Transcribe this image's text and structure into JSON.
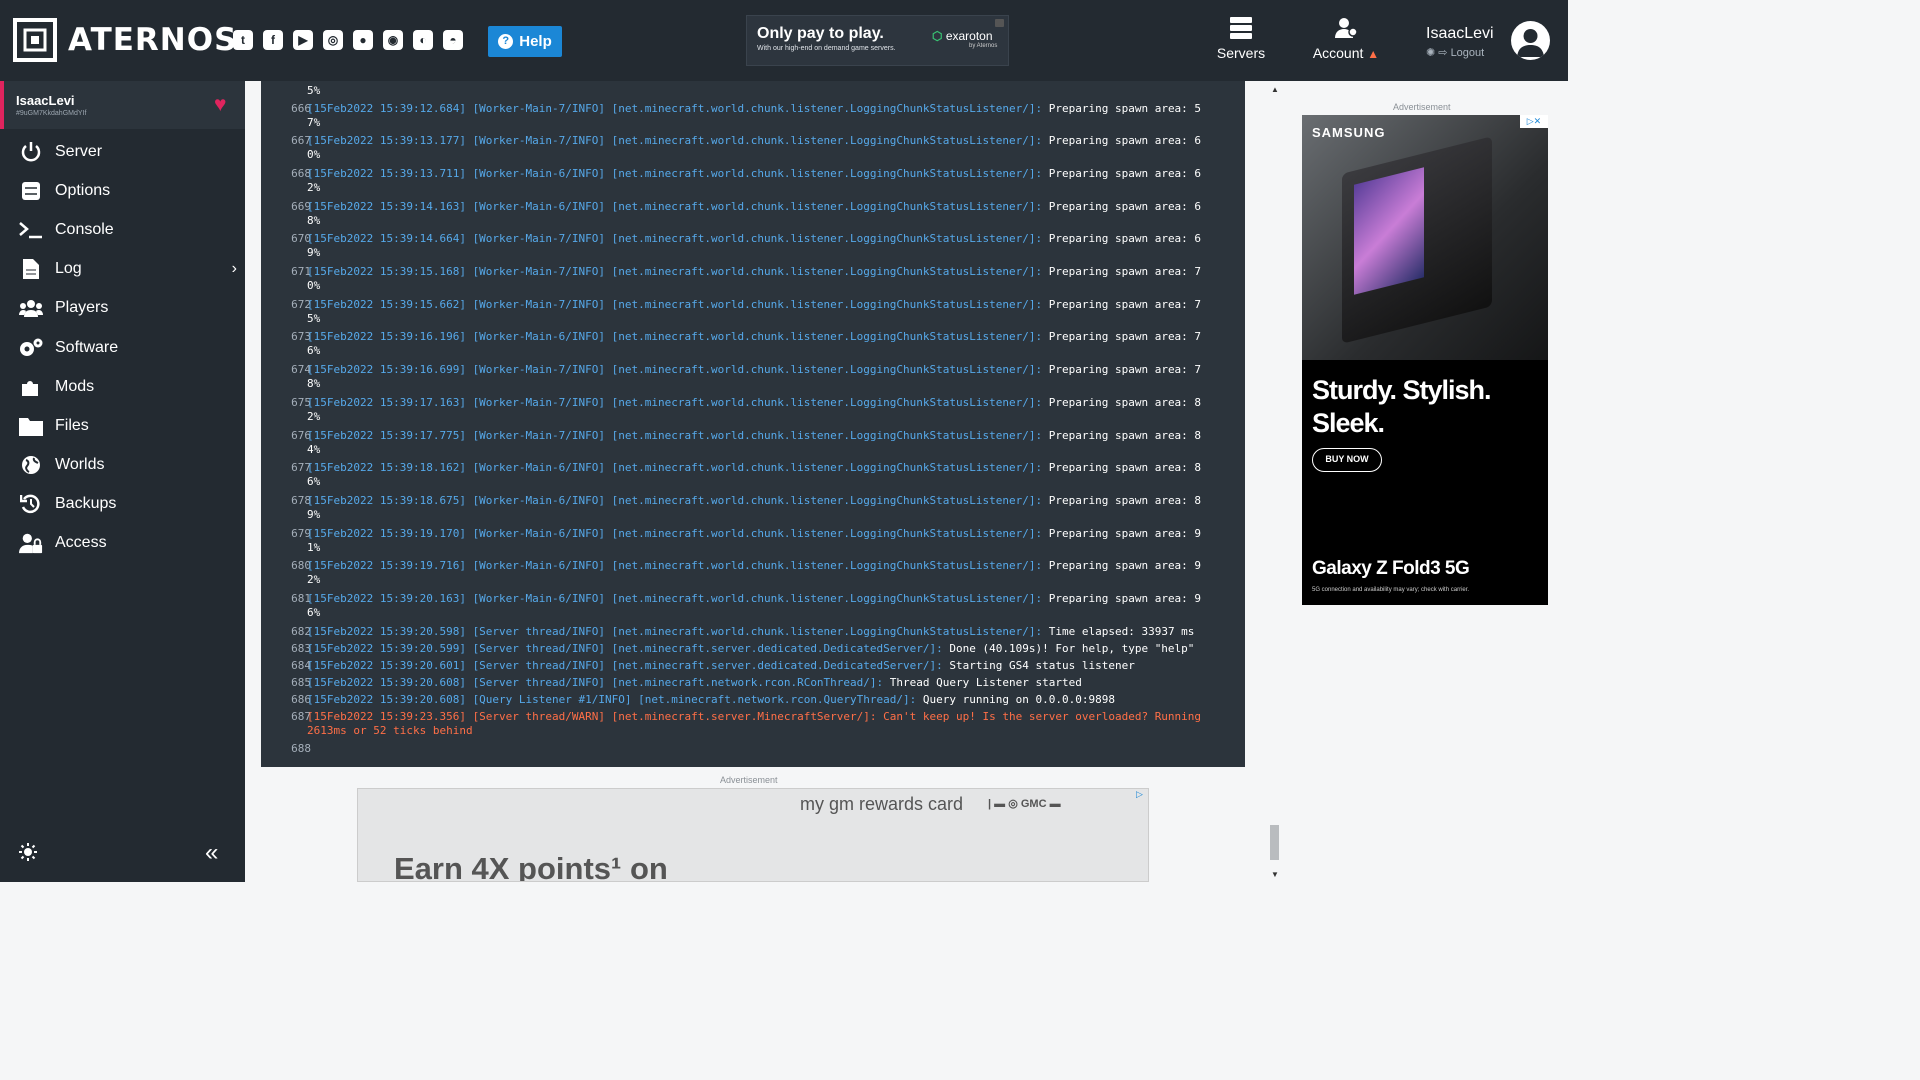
{
  "header": {
    "brand": "ATERNOS",
    "socials": [
      "twitter-icon",
      "facebook-icon",
      "youtube-icon",
      "instagram-icon",
      "reddit-icon",
      "discord-icon",
      "teamspeak-icon",
      "github-icon"
    ],
    "help_label": "Help",
    "top_ad": {
      "headline": "Only pay to play.",
      "sub": "With our high-end on demand game servers.",
      "brand": "exaroton",
      "by": "by Aternos"
    },
    "nav": [
      {
        "label": "Servers",
        "icon": "servers-icon"
      },
      {
        "label": "Account",
        "icon": "account-icon"
      }
    ],
    "user": {
      "name": "IsaacLevi",
      "logout": "Logout"
    }
  },
  "sidebar": {
    "server_name": "IsaacLevi",
    "server_id": "#9uGM7KkdahGMdYIf",
    "items": [
      {
        "label": "Server",
        "icon": "power-icon"
      },
      {
        "label": "Options",
        "icon": "sliders-icon"
      },
      {
        "label": "Console",
        "icon": "terminal-icon"
      },
      {
        "label": "Log",
        "icon": "file-icon"
      },
      {
        "label": "Players",
        "icon": "users-icon"
      },
      {
        "label": "Software",
        "icon": "gears-icon"
      },
      {
        "label": "Mods",
        "icon": "puzzle-icon"
      },
      {
        "label": "Files",
        "icon": "folder-icon"
      },
      {
        "label": "Worlds",
        "icon": "globe-icon"
      },
      {
        "label": "Backups",
        "icon": "history-icon"
      },
      {
        "label": "Access",
        "icon": "user-lock-icon"
      }
    ]
  },
  "console": {
    "lines": [
      {
        "n": "",
        "t": "5%",
        "c": "white"
      },
      {
        "n": "666",
        "ts": "[15Feb2022 15:39:12.684] [Worker-Main-7/INFO] [net.minecraft.world.chunk.listener.LoggingChunkStatusListener/]:",
        "msg": " Preparing spawn area: 5",
        "cont": "7%"
      },
      {
        "n": "667",
        "ts": "[15Feb2022 15:39:13.177] [Worker-Main-7/INFO] [net.minecraft.world.chunk.listener.LoggingChunkStatusListener/]:",
        "msg": " Preparing spawn area: 6",
        "cont": "0%"
      },
      {
        "n": "668",
        "ts": "[15Feb2022 15:39:13.711] [Worker-Main-6/INFO] [net.minecraft.world.chunk.listener.LoggingChunkStatusListener/]:",
        "msg": " Preparing spawn area: 6",
        "cont": "2%"
      },
      {
        "n": "669",
        "ts": "[15Feb2022 15:39:14.163] [Worker-Main-6/INFO] [net.minecraft.world.chunk.listener.LoggingChunkStatusListener/]:",
        "msg": " Preparing spawn area: 6",
        "cont": "8%"
      },
      {
        "n": "670",
        "ts": "[15Feb2022 15:39:14.664] [Worker-Main-7/INFO] [net.minecraft.world.chunk.listener.LoggingChunkStatusListener/]:",
        "msg": " Preparing spawn area: 6",
        "cont": "9%"
      },
      {
        "n": "671",
        "ts": "[15Feb2022 15:39:15.168] [Worker-Main-7/INFO] [net.minecraft.world.chunk.listener.LoggingChunkStatusListener/]:",
        "msg": " Preparing spawn area: 7",
        "cont": "0%"
      },
      {
        "n": "672",
        "ts": "[15Feb2022 15:39:15.662] [Worker-Main-7/INFO] [net.minecraft.world.chunk.listener.LoggingChunkStatusListener/]:",
        "msg": " Preparing spawn area: 7",
        "cont": "5%"
      },
      {
        "n": "673",
        "ts": "[15Feb2022 15:39:16.196] [Worker-Main-6/INFO] [net.minecraft.world.chunk.listener.LoggingChunkStatusListener/]:",
        "msg": " Preparing spawn area: 7",
        "cont": "6%"
      },
      {
        "n": "674",
        "ts": "[15Feb2022 15:39:16.699] [Worker-Main-7/INFO] [net.minecraft.world.chunk.listener.LoggingChunkStatusListener/]:",
        "msg": " Preparing spawn area: 7",
        "cont": "8%"
      },
      {
        "n": "675",
        "ts": "[15Feb2022 15:39:17.163] [Worker-Main-7/INFO] [net.minecraft.world.chunk.listener.LoggingChunkStatusListener/]:",
        "msg": " Preparing spawn area: 8",
        "cont": "2%"
      },
      {
        "n": "676",
        "ts": "[15Feb2022 15:39:17.775] [Worker-Main-7/INFO] [net.minecraft.world.chunk.listener.LoggingChunkStatusListener/]:",
        "msg": " Preparing spawn area: 8",
        "cont": "4%"
      },
      {
        "n": "677",
        "ts": "[15Feb2022 15:39:18.162] [Worker-Main-6/INFO] [net.minecraft.world.chunk.listener.LoggingChunkStatusListener/]:",
        "msg": " Preparing spawn area: 8",
        "cont": "6%"
      },
      {
        "n": "678",
        "ts": "[15Feb2022 15:39:18.675] [Worker-Main-6/INFO] [net.minecraft.world.chunk.listener.LoggingChunkStatusListener/]:",
        "msg": " Preparing spawn area: 8",
        "cont": "9%"
      },
      {
        "n": "679",
        "ts": "[15Feb2022 15:39:19.170] [Worker-Main-6/INFO] [net.minecraft.world.chunk.listener.LoggingChunkStatusListener/]:",
        "msg": " Preparing spawn area: 9",
        "cont": "1%"
      },
      {
        "n": "680",
        "ts": "[15Feb2022 15:39:19.716] [Worker-Main-6/INFO] [net.minecraft.world.chunk.listener.LoggingChunkStatusListener/]:",
        "msg": " Preparing spawn area: 9",
        "cont": "2%"
      },
      {
        "n": "681",
        "ts": "[15Feb2022 15:39:20.163] [Worker-Main-6/INFO] [net.minecraft.world.chunk.listener.LoggingChunkStatusListener/]:",
        "msg": " Preparing spawn area: 9",
        "cont": "6%"
      },
      {
        "n": "682",
        "ts": "[15Feb2022 15:39:20.598] [Server thread/INFO] [net.minecraft.world.chunk.listener.LoggingChunkStatusListener/]:",
        "msg": " Time elapsed: 33937 ms"
      },
      {
        "n": "683",
        "ts": "[15Feb2022 15:39:20.599] [Server thread/INFO] [net.minecraft.server.dedicated.DedicatedServer/]:",
        "msg": " Done (40.109s)! For help, type \"help\""
      },
      {
        "n": "684",
        "ts": "[15Feb2022 15:39:20.601] [Server thread/INFO] [net.minecraft.server.dedicated.DedicatedServer/]:",
        "msg": " Starting GS4 status listener"
      },
      {
        "n": "685",
        "ts": "[15Feb2022 15:39:20.608] [Server thread/INFO] [net.minecraft.network.rcon.RConThread/]:",
        "msg": " Thread Query Listener started"
      },
      {
        "n": "686",
        "ts": "[15Feb2022 15:39:20.608] [Query Listener #1/INFO] [net.minecraft.network.rcon.QueryThread/]:",
        "msg": " Query running on 0.0.0.0:9898"
      },
      {
        "n": "687",
        "warn": "[15Feb2022 15:39:23.356] [Server thread/WARN] [net.minecraft.server.MinecraftServer/]: Can't keep up! Is the server overloaded? Running",
        "cont_warn": "2613ms or 52 ticks behind"
      },
      {
        "n": "688",
        "t": "",
        "c": "white"
      }
    ]
  },
  "ads": {
    "label": "Advertisement",
    "side": {
      "brand": "SAMSUNG",
      "headline": "Sturdy. Stylish. Sleek.",
      "cta": "BUY NOW",
      "model": "Galaxy Z Fold3 5G",
      "fine": "5G connection and availability may vary; check with carrier."
    },
    "bottom": {
      "brand": "my gm rewards card",
      "headline": "Earn 4X points¹ on"
    }
  },
  "colors": {
    "topbar": "#232a31",
    "console_bg": "#2c343c",
    "log_blue": "#56a9ea",
    "warn": "#ff6f47",
    "help": "#1b87d6",
    "accent": "#e0245e"
  }
}
